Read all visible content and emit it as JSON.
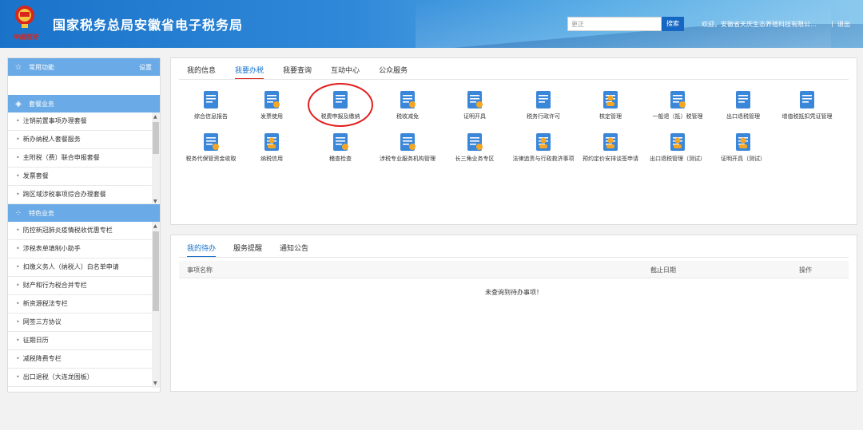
{
  "header": {
    "title": "国家税务总局安徽省电子税务局",
    "logo_text": "中国税务",
    "search_value": "更正",
    "search_label": "搜索",
    "welcome": "欢迎，安徽省天庆生态养殖科技有限公...",
    "separator": "|",
    "logout": "退出"
  },
  "sidebar": {
    "common": {
      "title": "常用功能",
      "settings": "设置"
    },
    "package": {
      "title": "套餐业务",
      "items": [
        "注销前置事项办理套餐",
        "新办纳税人套餐服务",
        "主附税（费）联合申报套餐",
        "发票套餐",
        "跨区域涉税事项综合办理套餐"
      ]
    },
    "special": {
      "title": "特色业务",
      "items": [
        "防控新冠肺炎疫情税收优惠专栏",
        "涉税表单填制小助手",
        "扣缴义务人（纳税人）白名单申请",
        "财产和行为税合并专栏",
        "新资源税法专栏",
        "网签三方协议",
        "征期日历",
        "减税降费专栏",
        "出口退税（大连龙图板）"
      ]
    }
  },
  "main": {
    "tabs": [
      "我的信息",
      "我要办税",
      "我要查询",
      "互动中心",
      "公众服务"
    ],
    "active_tab": "我要办税",
    "functions": [
      "综合信息报告",
      "发票使用",
      "税费申报及缴纳",
      "税收减免",
      "证明开具",
      "税务行政许可",
      "核定管理",
      "一般退（抵）税管理",
      "出口退税管理",
      "增值税抵扣凭证管理",
      "税务代保管资金收取",
      "纳税信用",
      "稽查检查",
      "涉税专业服务机构管理",
      "长三角业务专区",
      "法律追责与行政救济事项",
      "预约定价安排谈签申请",
      "出口退税管理（测试）",
      "证明开具（测试）"
    ],
    "highlighted": "税费申报及缴纳"
  },
  "todo": {
    "tabs": [
      "我的待办",
      "服务提醒",
      "通知公告"
    ],
    "columns": [
      "事项名称",
      "截止日期",
      "操作"
    ],
    "empty_text": "未查询到待办事项！"
  },
  "colors": {
    "brand_blue": "#1a73c9",
    "sidebar_head": "#6aaae6",
    "highlight_red": "#e21d1d",
    "icon_blue": "#3a86d8",
    "icon_orange": "#f5a623"
  }
}
